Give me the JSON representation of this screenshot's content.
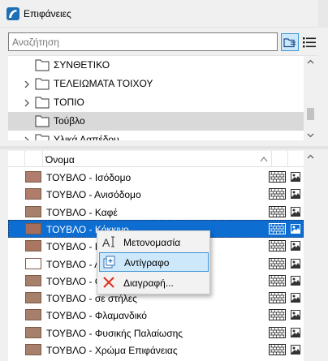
{
  "window": {
    "title": "Επιφάνειες",
    "title_icon": "archicad-icon"
  },
  "search": {
    "placeholder": "Αναζήτηση",
    "value": "",
    "folder_view_icon": "folder-view-icon",
    "list_view_icon": "list-view-icon"
  },
  "tree": {
    "items": [
      {
        "label": "ΣΥΝΘΕΤΙΚΟ",
        "expandable": false,
        "selected": false
      },
      {
        "label": "ΤΕΛΕΙΩΜΑΤΑ ΤΟΙΧΟΥ",
        "expandable": true,
        "selected": false
      },
      {
        "label": "ΤΟΠΙΟ",
        "expandable": true,
        "selected": false
      },
      {
        "label": "Τούβλο",
        "expandable": false,
        "selected": true
      },
      {
        "label": "Υλικά Δαπέδου",
        "expandable": true,
        "selected": false
      }
    ]
  },
  "list": {
    "header_name": "Όνομα",
    "rows": [
      {
        "label": "ΤΟΥΒΛΟ - Ισόδομο",
        "swatch": "#b07d6c",
        "selected": false
      },
      {
        "label": "ΤΟΥΒΛΟ - Ανισόδομο",
        "swatch": "#b07d6c",
        "selected": false
      },
      {
        "label": "ΤΟΥΒΛΟ - Καφέ",
        "swatch": "#a7806c",
        "selected": false
      },
      {
        "label": "ΤΟΥΒΛΟ - Κόκκινο",
        "swatch": "#a76d5c",
        "selected": true
      },
      {
        "label": "ΤΟΥΒΛΟ - Κό",
        "swatch": "#ab7563",
        "selected": false
      },
      {
        "label": "ΤΟΥΒΛΟ - Λε",
        "swatch": "#ffffff",
        "selected": false
      },
      {
        "label": "ΤΟΥΒΛΟ - Ορ",
        "swatch": "#a7806c",
        "selected": false
      },
      {
        "label": "ΤΟΥΒΛΟ - σε στήλες",
        "swatch": "#a7806c",
        "selected": false
      },
      {
        "label": "ΤΟΥΒΛΟ - Φλαμανδικό",
        "swatch": "#a7806c",
        "selected": false
      },
      {
        "label": "ΤΟΥΒΛΟ - Φυσικής Παλαίωσης",
        "swatch": "#a7806c",
        "selected": false
      },
      {
        "label": "ΤΟΥΒΛΟ - Χρώμα Επιφάνειας",
        "swatch": "#a7806c",
        "selected": false
      }
    ]
  },
  "context_menu": {
    "items": [
      {
        "label": "Μετονομασία",
        "icon": "rename-icon",
        "highlighted": false
      },
      {
        "label": "Αντίγραφο",
        "icon": "duplicate-icon",
        "highlighted": true
      },
      {
        "label": "Διαγραφή...",
        "icon": "delete-icon",
        "highlighted": false
      }
    ]
  },
  "colors": {
    "selection": "#0e6dd0",
    "highlight": "#cde8fb",
    "highlight_border": "#3e95d6",
    "delete_red": "#e0301e"
  }
}
